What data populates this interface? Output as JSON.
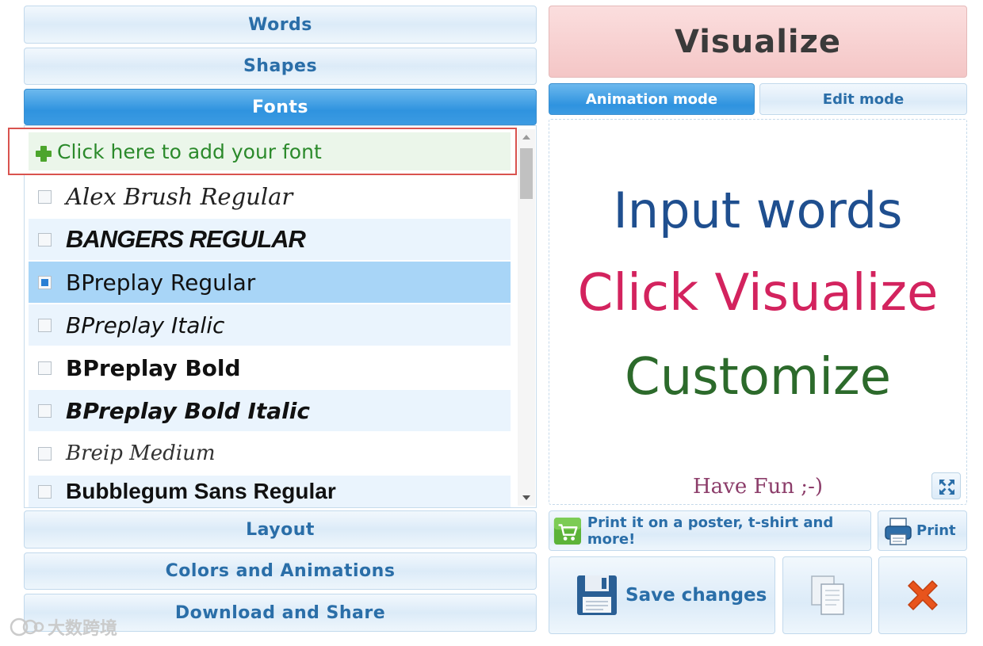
{
  "accordion": {
    "words": "Words",
    "shapes": "Shapes",
    "fonts": "Fonts",
    "layout": "Layout",
    "colors": "Colors and Animations",
    "download": "Download and Share"
  },
  "fonts_panel": {
    "add_font_label": "Click here to add your font",
    "items": [
      {
        "name": "Alex Brush Regular",
        "checked": false
      },
      {
        "name": "BANGERS REGULAR",
        "checked": false
      },
      {
        "name": "BPreplay Regular",
        "checked": true
      },
      {
        "name": "BPreplay Italic",
        "checked": false
      },
      {
        "name": "BPreplay Bold",
        "checked": false
      },
      {
        "name": "BPreplay Bold Italic",
        "checked": false
      },
      {
        "name": "Breip Medium",
        "checked": false
      },
      {
        "name": "Bubblegum Sans Regular",
        "checked": false
      }
    ]
  },
  "right_panel": {
    "visualize_label": "Visualize",
    "tabs": {
      "animation": "Animation mode",
      "edit": "Edit mode"
    },
    "preview": {
      "line1": "Input words",
      "line2": "Click Visualize",
      "line3": "Customize",
      "fun": "Have Fun ;-)"
    },
    "print_poster_label": "Print it on a poster, t-shirt and more!",
    "print_label": "Print",
    "save_label": "Save changes"
  },
  "watermark": "大数跨境",
  "colors": {
    "accent_blue": "#2f93df",
    "visualize_pink": "#f4c6c6",
    "add_font_green": "#2b8a2b",
    "delete_orange": "#e8541c"
  }
}
